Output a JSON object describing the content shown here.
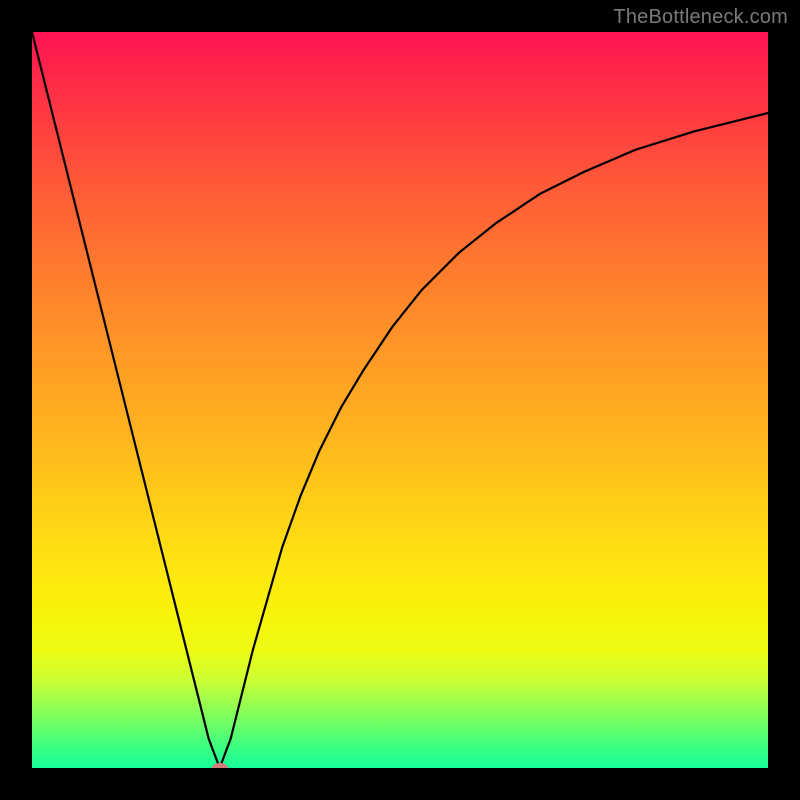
{
  "watermark": "TheBottleneck.com",
  "chart_data": {
    "type": "line",
    "title": "",
    "xlabel": "",
    "ylabel": "",
    "xlim": [
      0,
      100
    ],
    "ylim": [
      0,
      100
    ],
    "grid": false,
    "legend": false,
    "background_gradient": {
      "direction": "vertical",
      "stops": [
        {
          "pos": 0.0,
          "color": "#ff1352"
        },
        {
          "pos": 0.2,
          "color": "#ff5738"
        },
        {
          "pos": 0.44,
          "color": "#ff9a26"
        },
        {
          "pos": 0.66,
          "color": "#ffd316"
        },
        {
          "pos": 0.79,
          "color": "#f9f30a"
        },
        {
          "pos": 0.88,
          "color": "#ccff33"
        },
        {
          "pos": 1.0,
          "color": "#15ff99"
        }
      ]
    },
    "series": [
      {
        "name": "bottleneck-curve",
        "color": "#000000",
        "x": [
          0.0,
          2.0,
          4.0,
          6.0,
          8.0,
          10.0,
          12.0,
          14.0,
          16.0,
          18.0,
          20.0,
          22.0,
          24.0,
          25.5,
          27.0,
          28.5,
          30.0,
          32.0,
          34.0,
          36.5,
          39.0,
          42.0,
          45.0,
          49.0,
          53.0,
          58.0,
          63.0,
          69.0,
          75.0,
          82.0,
          90.0,
          100.0
        ],
        "y": [
          100.0,
          92.0,
          84.0,
          76.0,
          68.0,
          60.0,
          52.0,
          44.0,
          36.0,
          28.0,
          20.0,
          12.0,
          4.0,
          0.0,
          4.0,
          10.0,
          16.0,
          23.0,
          30.0,
          37.0,
          43.0,
          49.0,
          54.0,
          60.0,
          65.0,
          70.0,
          74.0,
          78.0,
          81.0,
          84.0,
          86.5,
          89.0
        ]
      }
    ],
    "markers": [
      {
        "name": "optimum-marker",
        "x": 25.5,
        "y": 0.0,
        "color": "#d77b7b"
      }
    ]
  }
}
